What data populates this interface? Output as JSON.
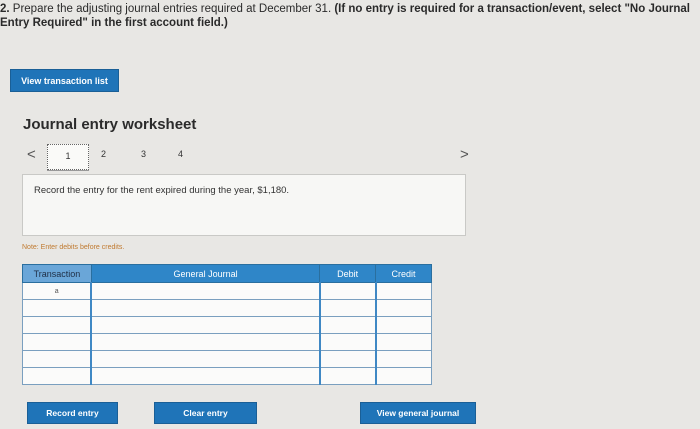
{
  "question": {
    "number": "2.",
    "text": " Prepare the adjusting journal entries required at December 31. ",
    "bold": "(If no entry is required for a transaction/event, select \"No Journal Entry Required\" in the first account field.)"
  },
  "buttons": {
    "view_transaction_list": "View transaction list",
    "record_entry": "Record entry",
    "clear_entry": "Clear entry",
    "view_general_journal": "View general journal"
  },
  "worksheet": {
    "title": "Journal entry worksheet",
    "prev": "<",
    "next": ">",
    "pages": [
      "1",
      "2",
      "3",
      "4"
    ],
    "instruction": "Record the entry for the rent expired during the year, $1,180.",
    "note": "Note: Enter debits before credits."
  },
  "table": {
    "headers": [
      "Transaction",
      "General Journal",
      "Debit",
      "Credit"
    ],
    "rows": [
      [
        "a",
        "",
        "",
        ""
      ],
      [
        "",
        "",
        "",
        ""
      ],
      [
        "",
        "",
        "",
        ""
      ],
      [
        "",
        "",
        "",
        ""
      ],
      [
        "",
        "",
        "",
        ""
      ],
      [
        "",
        "",
        "",
        ""
      ]
    ]
  },
  "colors": {
    "primary_button": "#1f74b8",
    "table_header": "#2f86c8"
  }
}
